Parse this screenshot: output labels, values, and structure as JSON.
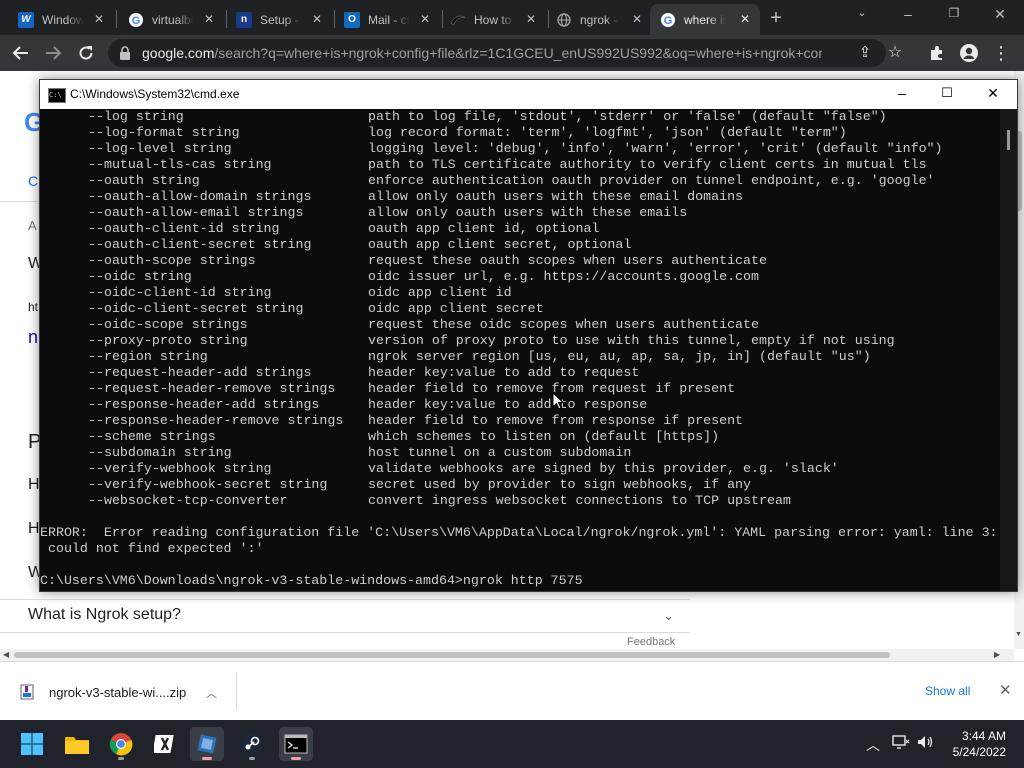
{
  "browser": {
    "tabs": [
      {
        "title": "Windows",
        "icon": "windows-favicon",
        "color": "#1565c0"
      },
      {
        "title": "virtualbox",
        "icon": "google-favicon",
        "color": "#ffffff"
      },
      {
        "title": "Setup - ngrok",
        "icon": "ngrok-n-favicon",
        "color": "#1a3a8a"
      },
      {
        "title": "Mail - cr",
        "icon": "outlook-favicon",
        "color": "#0f6cbd"
      },
      {
        "title": "How to",
        "icon": "swoosh-favicon",
        "color": "#000000"
      },
      {
        "title": "ngrok - Re",
        "icon": "globe-favicon",
        "color": "#9aa0a6"
      },
      {
        "title": "where is",
        "icon": "google-favicon",
        "color": "#ffffff",
        "active": true
      }
    ],
    "url_host": "google.com",
    "url_rest": "/search?q=where+is+ngrok+config+file&rlz=1C1GCEU_enUS992US992&oq=where+is+ngrok+conf..."
  },
  "google_page": {
    "fragments": [
      "G",
      "C",
      "A",
      "W",
      "ht",
      "n",
      "P",
      "H",
      "H",
      "W"
    ],
    "faq_question": "What is Ngrok setup?",
    "feedback": "Feedback"
  },
  "cmd": {
    "title": "C:\\Windows\\System32\\cmd.exe",
    "options": [
      {
        "flag": "--log string",
        "desc": "path to log file, 'stdout', 'stderr' or 'false' (default \"false\")"
      },
      {
        "flag": "--log-format string",
        "desc": "log record format: 'term', 'logfmt', 'json' (default \"term\")"
      },
      {
        "flag": "--log-level string",
        "desc": "logging level: 'debug', 'info', 'warn', 'error', 'crit' (default \"info\")"
      },
      {
        "flag": "--mutual-tls-cas string",
        "desc": "path to TLS certificate authority to verify client certs in mutual tls"
      },
      {
        "flag": "--oauth string",
        "desc": "enforce authentication oauth provider on tunnel endpoint, e.g. 'google'"
      },
      {
        "flag": "--oauth-allow-domain strings",
        "desc": "allow only oauth users with these email domains"
      },
      {
        "flag": "--oauth-allow-email strings",
        "desc": "allow only oauth users with these emails"
      },
      {
        "flag": "--oauth-client-id string",
        "desc": "oauth app client id, optional"
      },
      {
        "flag": "--oauth-client-secret string",
        "desc": "oauth app client secret, optional"
      },
      {
        "flag": "--oauth-scope strings",
        "desc": "request these oauth scopes when users authenticate"
      },
      {
        "flag": "--oidc string",
        "desc": "oidc issuer url, e.g. https://accounts.google.com"
      },
      {
        "flag": "--oidc-client-id string",
        "desc": "oidc app client id"
      },
      {
        "flag": "--oidc-client-secret string",
        "desc": "oidc app client secret"
      },
      {
        "flag": "--oidc-scope strings",
        "desc": "request these oidc scopes when users authenticate"
      },
      {
        "flag": "--proxy-proto string",
        "desc": "version of proxy proto to use with this tunnel, empty if not using"
      },
      {
        "flag": "--region string",
        "desc": "ngrok server region [us, eu, au, ap, sa, jp, in] (default \"us\")"
      },
      {
        "flag": "--request-header-add strings",
        "desc": "header key:value to add to request"
      },
      {
        "flag": "--request-header-remove strings",
        "desc": "header field to remove from request if present"
      },
      {
        "flag": "--response-header-add strings",
        "desc": "header key:value to add to response"
      },
      {
        "flag": "--response-header-remove strings",
        "desc": "header field to remove from response if present"
      },
      {
        "flag": "--scheme strings",
        "desc": "which schemes to listen on (default [https])"
      },
      {
        "flag": "--subdomain string",
        "desc": "host tunnel on a custom subdomain"
      },
      {
        "flag": "--verify-webhook string",
        "desc": "validate webhooks are signed by this provider, e.g. 'slack'"
      },
      {
        "flag": "--verify-webhook-secret string",
        "desc": "secret used by provider to sign webhooks, if any"
      },
      {
        "flag": "--websocket-tcp-converter",
        "desc": "convert ingress websocket connections to TCP upstream"
      }
    ],
    "error_line1": "ERROR:  Error reading configuration file 'C:\\Users\\VM6\\AppData\\Local/ngrok/ngrok.yml': YAML parsing error: yaml: line 3:",
    "error_line2": " could not find expected ':'",
    "prompt": "C:\\Users\\VM6\\Downloads\\ngrok-v3-stable-windows-amd64>ngrok http 7575"
  },
  "downloads": {
    "file_name": "ngrok-v3-stable-wi....zip",
    "show_all": "Show all"
  },
  "taskbar": {
    "apps": [
      "start-icon",
      "file-explorer-icon",
      "chrome-icon",
      "xbox-icon",
      "virtualbox-icon",
      "steam-icon",
      "cmd-icon"
    ],
    "time": "3:44 AM",
    "date": "5/24/2022"
  }
}
